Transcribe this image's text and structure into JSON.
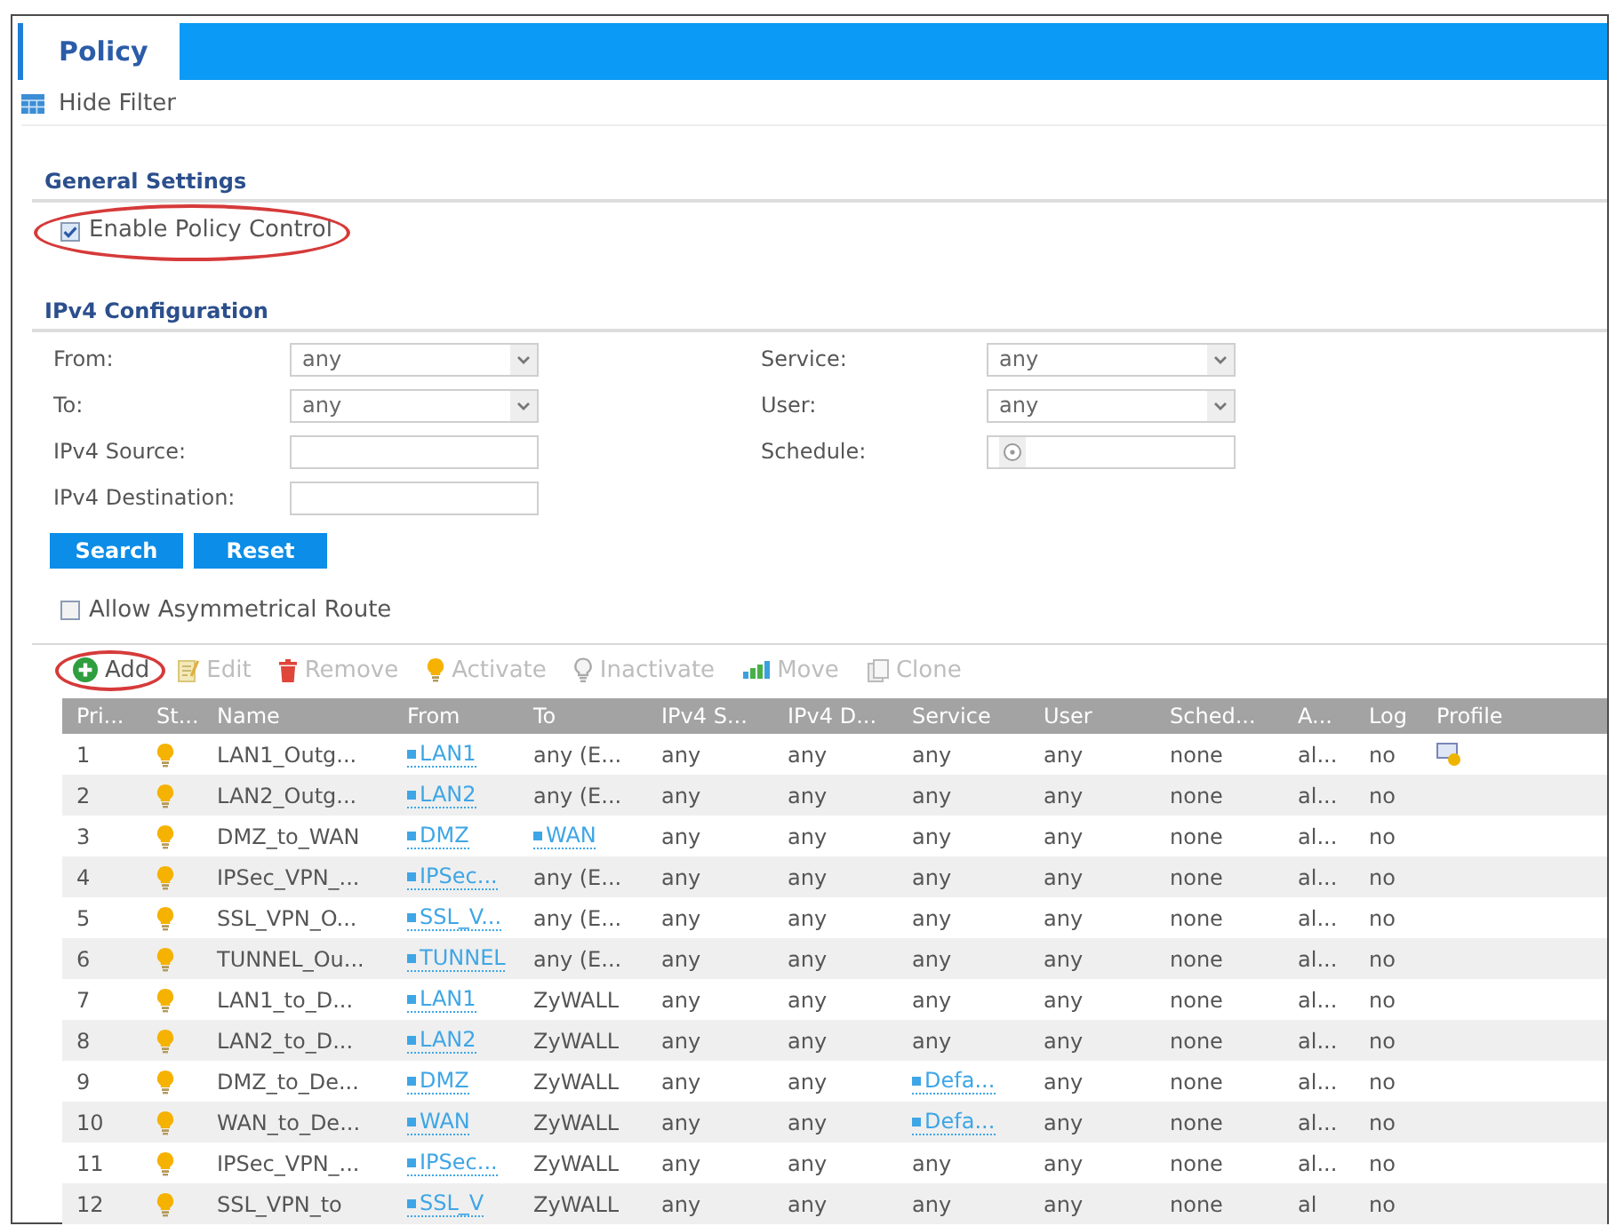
{
  "tabs": [
    {
      "label": "Policy",
      "selected": true
    }
  ],
  "filter_toggle": {
    "label": "Hide Filter"
  },
  "general_settings": {
    "title": "General Settings",
    "enable_policy_control": {
      "label": "Enable Policy Control",
      "checked": true,
      "highlighted": true
    }
  },
  "ipv4_configuration": {
    "title": "IPv4 Configuration",
    "fields": [
      {
        "label": "From:",
        "kind": "select",
        "value": "any"
      },
      {
        "label": "Service:",
        "kind": "select",
        "value": "any"
      },
      {
        "label": "To:",
        "kind": "select",
        "value": "any"
      },
      {
        "label": "User:",
        "kind": "select",
        "value": "any"
      },
      {
        "label": "IPv4 Source:",
        "kind": "text"
      },
      {
        "label": "Schedule:",
        "kind": "picker"
      },
      {
        "label": "IPv4 Destination:",
        "kind": "text"
      }
    ],
    "buttons": [
      {
        "label": "Search"
      },
      {
        "label": "Reset"
      }
    ]
  },
  "allow_asymmetrical_route": {
    "label": "Allow Asymmetrical Route",
    "checked": false
  },
  "toolbar": [
    {
      "label": "Add",
      "kind": "add",
      "disabled": false,
      "highlighted": true
    },
    {
      "label": "Edit",
      "kind": "edit",
      "disabled": true,
      "highlighted": false
    },
    {
      "label": "Remove",
      "kind": "remove",
      "disabled": true,
      "highlighted": false
    },
    {
      "label": "Activate",
      "kind": "activate",
      "disabled": true,
      "highlighted": false
    },
    {
      "label": "Inactivate",
      "kind": "inactivate",
      "disabled": true,
      "highlighted": false
    },
    {
      "label": "Move",
      "kind": "move",
      "disabled": true,
      "highlighted": false
    },
    {
      "label": "Clone",
      "kind": "clone",
      "disabled": true,
      "highlighted": false
    }
  ],
  "table": {
    "columns": [
      "Pri...",
      "St...",
      "Name",
      "From",
      "To",
      "IPv4 S...",
      "IPv4 D...",
      "Service",
      "User",
      "Sched...",
      "A...",
      "Log",
      "Profile"
    ],
    "rows": [
      {
        "priority": "1",
        "active": true,
        "name": "LAN1_Outg...",
        "from": {
          "kind": "link",
          "text": "LAN1"
        },
        "to": {
          "kind": "plain",
          "text": "any (E..."
        },
        "ipv4_source": "any",
        "ipv4_destination": "any",
        "service": {
          "kind": "plain",
          "text": "any"
        },
        "user": "any",
        "schedule": "none",
        "action": "al...",
        "log": "no",
        "has_profile": true
      },
      {
        "priority": "2",
        "active": true,
        "name": "LAN2_Outg...",
        "from": {
          "kind": "link",
          "text": "LAN2"
        },
        "to": {
          "kind": "plain",
          "text": "any (E..."
        },
        "ipv4_source": "any",
        "ipv4_destination": "any",
        "service": {
          "kind": "plain",
          "text": "any"
        },
        "user": "any",
        "schedule": "none",
        "action": "al...",
        "log": "no",
        "has_profile": false
      },
      {
        "priority": "3",
        "active": true,
        "name": "DMZ_to_WAN",
        "from": {
          "kind": "link",
          "text": "DMZ"
        },
        "to": {
          "kind": "link",
          "text": "WAN"
        },
        "ipv4_source": "any",
        "ipv4_destination": "any",
        "service": {
          "kind": "plain",
          "text": "any"
        },
        "user": "any",
        "schedule": "none",
        "action": "al...",
        "log": "no",
        "has_profile": false
      },
      {
        "priority": "4",
        "active": true,
        "name": "IPSec_VPN_...",
        "from": {
          "kind": "link",
          "text": "IPSec..."
        },
        "to": {
          "kind": "plain",
          "text": "any (E..."
        },
        "ipv4_source": "any",
        "ipv4_destination": "any",
        "service": {
          "kind": "plain",
          "text": "any"
        },
        "user": "any",
        "schedule": "none",
        "action": "al...",
        "log": "no",
        "has_profile": false
      },
      {
        "priority": "5",
        "active": true,
        "name": "SSL_VPN_O...",
        "from": {
          "kind": "link",
          "text": "SSL_V..."
        },
        "to": {
          "kind": "plain",
          "text": "any (E..."
        },
        "ipv4_source": "any",
        "ipv4_destination": "any",
        "service": {
          "kind": "plain",
          "text": "any"
        },
        "user": "any",
        "schedule": "none",
        "action": "al...",
        "log": "no",
        "has_profile": false
      },
      {
        "priority": "6",
        "active": true,
        "name": "TUNNEL_Ou...",
        "from": {
          "kind": "link",
          "text": "TUNNEL"
        },
        "to": {
          "kind": "plain",
          "text": "any (E..."
        },
        "ipv4_source": "any",
        "ipv4_destination": "any",
        "service": {
          "kind": "plain",
          "text": "any"
        },
        "user": "any",
        "schedule": "none",
        "action": "al...",
        "log": "no",
        "has_profile": false
      },
      {
        "priority": "7",
        "active": true,
        "name": "LAN1_to_D...",
        "from": {
          "kind": "link",
          "text": "LAN1"
        },
        "to": {
          "kind": "plain",
          "text": "ZyWALL"
        },
        "ipv4_source": "any",
        "ipv4_destination": "any",
        "service": {
          "kind": "plain",
          "text": "any"
        },
        "user": "any",
        "schedule": "none",
        "action": "al...",
        "log": "no",
        "has_profile": false
      },
      {
        "priority": "8",
        "active": true,
        "name": "LAN2_to_D...",
        "from": {
          "kind": "link",
          "text": "LAN2"
        },
        "to": {
          "kind": "plain",
          "text": "ZyWALL"
        },
        "ipv4_source": "any",
        "ipv4_destination": "any",
        "service": {
          "kind": "plain",
          "text": "any"
        },
        "user": "any",
        "schedule": "none",
        "action": "al...",
        "log": "no",
        "has_profile": false
      },
      {
        "priority": "9",
        "active": true,
        "name": "DMZ_to_De...",
        "from": {
          "kind": "link",
          "text": "DMZ"
        },
        "to": {
          "kind": "plain",
          "text": "ZyWALL"
        },
        "ipv4_source": "any",
        "ipv4_destination": "any",
        "service": {
          "kind": "link",
          "text": "Defa..."
        },
        "user": "any",
        "schedule": "none",
        "action": "al...",
        "log": "no",
        "has_profile": false
      },
      {
        "priority": "10",
        "active": true,
        "name": "WAN_to_De...",
        "from": {
          "kind": "link",
          "text": "WAN"
        },
        "to": {
          "kind": "plain",
          "text": "ZyWALL"
        },
        "ipv4_source": "any",
        "ipv4_destination": "any",
        "service": {
          "kind": "link",
          "text": "Defa..."
        },
        "user": "any",
        "schedule": "none",
        "action": "al...",
        "log": "no",
        "has_profile": false
      },
      {
        "priority": "11",
        "active": true,
        "name": "IPSec_VPN_...",
        "from": {
          "kind": "link",
          "text": "IPSec..."
        },
        "to": {
          "kind": "plain",
          "text": "ZyWALL"
        },
        "ipv4_source": "any",
        "ipv4_destination": "any",
        "service": {
          "kind": "plain",
          "text": "any"
        },
        "user": "any",
        "schedule": "none",
        "action": "al...",
        "log": "no",
        "has_profile": false
      },
      {
        "priority": "12",
        "active": true,
        "name": "SSL_VPN_to",
        "from": {
          "kind": "link",
          "text": "SSL_V"
        },
        "to": {
          "kind": "plain",
          "text": "ZyWALL"
        },
        "ipv4_source": "any",
        "ipv4_destination": "any",
        "service": {
          "kind": "plain",
          "text": "any"
        },
        "user": "any",
        "schedule": "none",
        "action": "al",
        "log": "no",
        "has_profile": false
      }
    ]
  }
}
